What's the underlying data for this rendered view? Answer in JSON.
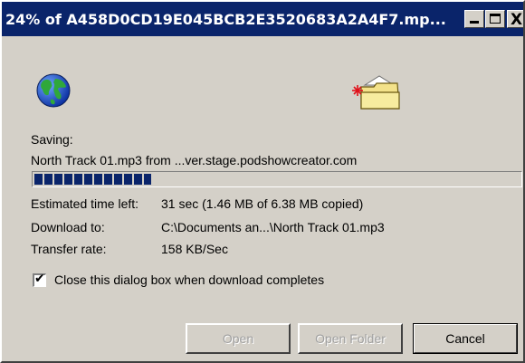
{
  "window": {
    "title": "24% of A458D0CD19E045BCB2E3520683A2A4F7.mp...",
    "buttons": {
      "minimize": "_",
      "maximize": "□",
      "close": "X"
    }
  },
  "icons": {
    "source": "globe-icon",
    "destination": "folder-icon"
  },
  "status": {
    "saving_label": "Saving:",
    "file_line": "North Track 01.mp3 from ...ver.stage.podshowcreator.com",
    "progress_percent": 24
  },
  "details": [
    {
      "key": "Estimated time left:",
      "value": "31 sec (1.46 MB of 6.38 MB copied)"
    },
    {
      "key": "Download to:",
      "value": "C:\\Documents an...\\North Track 01.mp3"
    },
    {
      "key": "Transfer rate:",
      "value": "158 KB/Sec"
    }
  ],
  "checkbox": {
    "label": "Close this dialog box when download completes",
    "checked": true
  },
  "actions": {
    "open": "Open",
    "open_folder": "Open Folder",
    "cancel": "Cancel"
  },
  "colors": {
    "titlebar": "#0a246a",
    "progress": "#0a246a",
    "face": "#d4d0c8"
  }
}
